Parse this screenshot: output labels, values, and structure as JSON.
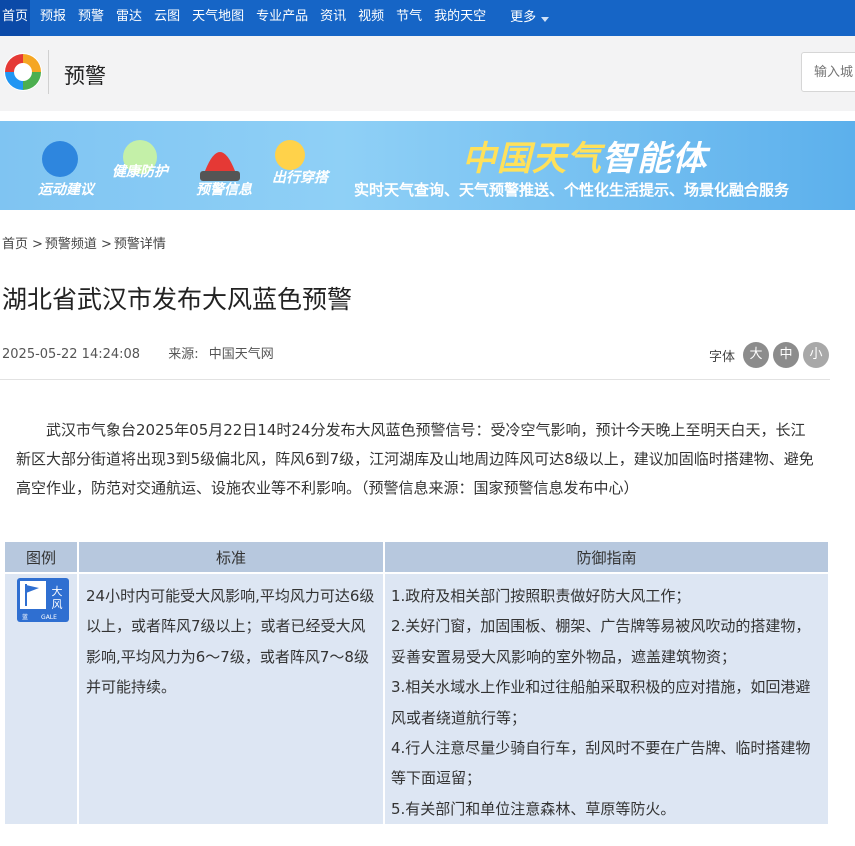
{
  "topnav": {
    "items": [
      "首页",
      "预报",
      "预警",
      "雷达",
      "云图",
      "天气地图",
      "专业产品",
      "资讯",
      "视频",
      "节气",
      "我的天空"
    ],
    "more": "更多",
    "active_index": 0
  },
  "header": {
    "section_title": "预警",
    "search_placeholder": "输入城"
  },
  "banner": {
    "items": [
      "运动建议",
      "健康防护",
      "预警信息",
      "出行穿搭"
    ],
    "headline_a": "中国天气",
    "headline_b": "智能体",
    "subline": "实时天气查询、天气预警推送、个性化生活提示、场景化融合服务"
  },
  "breadcrumb": [
    "首页",
    "预警频道",
    "预警详情"
  ],
  "article": {
    "title": "湖北省武汉市发布大风蓝色预警",
    "datetime": "2025-05-22 14:24:08",
    "source_label": "来源:",
    "source_value": "中国天气网",
    "fontsize_label": "字体",
    "fontsize_options": [
      "大",
      "中",
      "小"
    ],
    "fontsize_active": "中",
    "body": "武汉市气象台2025年05月22日14时24分发布大风蓝色预警信号：受冷空气影响，预计今天晚上至明天白天，长江新区大部分街道将出现3到5级偏北风，阵风6到7级，江河湖库及山地周边阵风可达8级以上，建议加固临时搭建物、避免高空作业，防范对交通航运、设施农业等不利影响。（预警信息来源：国家预警信息发布中心）"
  },
  "warn_table": {
    "headers": [
      "图例",
      "标准",
      "防御指南"
    ],
    "icon": {
      "name": "gale-blue-warning-icon",
      "text_cn": "大风",
      "text_en": "GALE",
      "text_level": "蓝",
      "color": "#2f6fd1"
    },
    "standard": "24小时内可能受大风影响,平均风力可达6级以上，或者阵风7级以上；或者已经受大风影响,平均风力为6～7级，或者阵风7～8级并可能持续。",
    "guide": [
      "1.政府及相关部门按照职责做好防大风工作；",
      "2.关好门窗，加固围板、棚架、广告牌等易被风吹动的搭建物，妥善安置易受大风影响的室外物品，遮盖建筑物资；",
      "3.相关水域水上作业和过往船舶采取积极的应对措施，如回港避风或者绕道航行等；",
      "4.行人注意尽量少骑自行车，刮风时不要在广告牌、临时搭建物等下面逗留；",
      "5.有关部门和单位注意森林、草原等防火。"
    ]
  },
  "colors": {
    "nav_bg": "#1665c6",
    "header_bg": "#f3f3f4",
    "table_head": "#b7c8de",
    "table_cell": "#dde6f3"
  }
}
